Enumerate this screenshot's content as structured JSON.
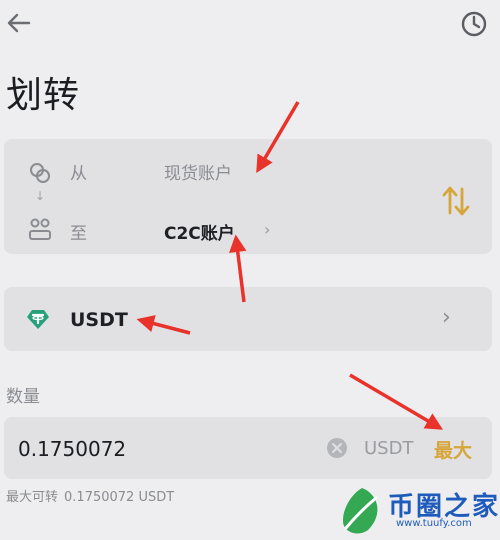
{
  "header": {
    "title": "划转"
  },
  "transfer": {
    "from_label": "从",
    "from_value": "现货账户",
    "to_label": "至",
    "to_value": "C2C账户",
    "to_chevron": "›",
    "down_arrow": "↓"
  },
  "coin": {
    "name": "USDT",
    "chevron": "›"
  },
  "amount": {
    "label": "数量",
    "value": "0.1750072",
    "unit": "USDT",
    "max_label": "最大",
    "max_transferable_label": "最大可转",
    "max_transferable_value": "0.1750072 USDT"
  },
  "watermark": {
    "name": "币圈之家",
    "url": "www.tuufy.com"
  },
  "colors": {
    "background": "#eeeef0",
    "card": "#e1e1e4",
    "accent_gold": "#d7a63a",
    "usdt_green": "#26a17b",
    "annotation_red": "#e8322a",
    "watermark_blue": "#1e5bbd"
  },
  "icons": [
    "back-arrow-icon",
    "history-clock-icon",
    "from-account-icon",
    "to-account-icon",
    "swap-icon",
    "usdt-coin-icon",
    "clear-icon",
    "chevron-right-icon"
  ]
}
